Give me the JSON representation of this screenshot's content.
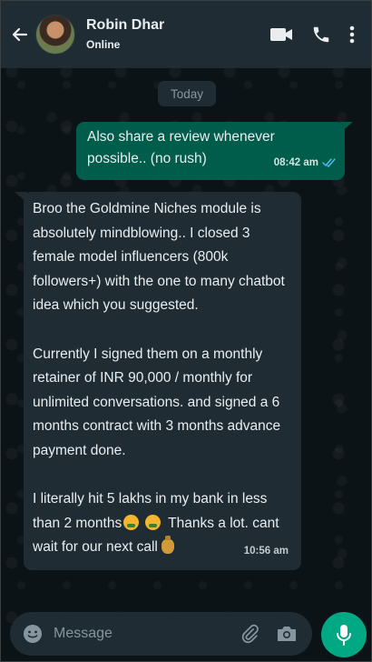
{
  "header": {
    "contact_name": "Robin Dhar",
    "status": "Online",
    "icons": [
      "back-arrow-icon",
      "video-call-icon",
      "voice-call-icon",
      "more-options-icon"
    ]
  },
  "date_chip": "Today",
  "messages": [
    {
      "direction": "outgoing",
      "lines": [
        "Also share a review whenever",
        "possible.. (no rush)"
      ],
      "time": "08:42 am",
      "read_receipt": "double-check-icon"
    },
    {
      "direction": "incoming",
      "paragraphs": [
        "Broo the Goldmine Niches module is absolutely mindblowing.. I closed 3 female model influencers (800k followers+) with the one to many chatbot idea which you suggested.",
        "Currently I signed them on a monthly retainer of INR 90,000 / monthly for unlimited conversations. and signed a 6 months contract with 3 months advance payment done.",
        "I literally hit 5 lakhs in my bank in less than 2 months",
        "Thanks a lot. cant wait for our next call"
      ],
      "emojis": [
        "money-mouth-face-icon",
        "money-mouth-face-icon",
        "money-bag-icon"
      ],
      "time": "10:56 am"
    }
  ],
  "composer": {
    "placeholder": "Message",
    "icons": [
      "emoji-icon",
      "attachment-icon",
      "camera-icon",
      "mic-icon"
    ]
  },
  "colors": {
    "header_bg": "#1f2c34",
    "outgoing_bubble": "#005c4b",
    "incoming_bubble": "#1f2c34",
    "accent": "#00a884",
    "read_tick": "#53bdeb"
  }
}
